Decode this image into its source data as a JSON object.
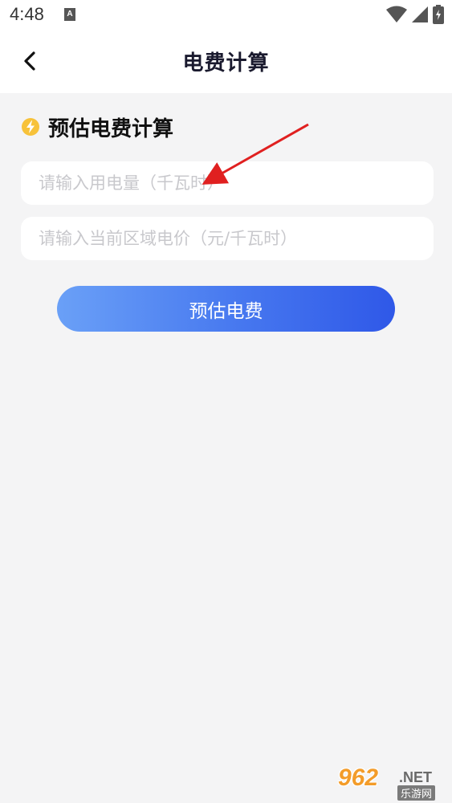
{
  "status_bar": {
    "time": "4:48",
    "notification_icon": "A"
  },
  "nav": {
    "title": "电费计算",
    "back_icon": "chevron-left-icon"
  },
  "section": {
    "title": "预估电费计算",
    "icon": "lightning-bolt-icon",
    "icon_color": "#f7c23a"
  },
  "form": {
    "usage": {
      "value": "",
      "placeholder": "请输入用电量（千瓦时）"
    },
    "price": {
      "value": "",
      "placeholder": "请输入当前区域电价（元/千瓦时）"
    },
    "submit_label": "预估电费"
  },
  "colors": {
    "accent_start": "#6aa0f7",
    "accent_end": "#2f58e8",
    "background": "#f4f4f5"
  },
  "watermark": {
    "number": "962",
    "suffix": ".NET",
    "subtitle": "乐游网"
  }
}
